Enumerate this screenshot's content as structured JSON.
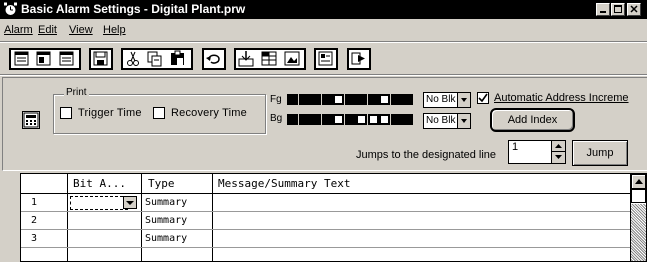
{
  "window": {
    "title": "Basic Alarm Settings - Digital Plant.prw",
    "icon": "clock-icon"
  },
  "menu": [
    "Alarm",
    "Edit",
    "View",
    "Help"
  ],
  "toolbar_icons": [
    "view-icon",
    "split-view-icon",
    "list-view-icon",
    "save-icon",
    "cut-icon",
    "copy-icon",
    "paste-icon",
    "undo-icon",
    "import-icon",
    "grid-icon",
    "image-icon",
    "properties-icon",
    "run-icon"
  ],
  "print": {
    "group_label": "Print",
    "trigger_label": "Trigger Time",
    "recovery_label": "Recovery Time",
    "trigger_checked": false,
    "recovery_checked": false
  },
  "colors": {
    "fg_label": "Fg",
    "bg_label": "Bg",
    "fg_swatches": [
      "#000000",
      "#000000",
      "#000000",
      "#000000",
      "#ffffff",
      "#000000",
      "#000000",
      "#000000",
      "#ffffff",
      "#000000",
      "#000000"
    ],
    "bg_swatches": [
      "#000000",
      "#000000",
      "#000000",
      "#000000",
      "#ffffff",
      "#000000",
      "#ffffff",
      "#ffffff",
      "#ffffff",
      "#000000",
      "#000000"
    ],
    "fg_blink": "No Blk",
    "bg_blink": "No Blk"
  },
  "auto_address": {
    "label": "Automatic Address Increme",
    "checked": true
  },
  "add_index_label": "Add Index",
  "jump": {
    "label": "Jumps to the designated line",
    "value": "1",
    "button": "Jump"
  },
  "grid": {
    "columns": [
      "",
      "Bit A...",
      "Type",
      "Message/Summary Text"
    ],
    "rows": [
      {
        "num": "1",
        "bit": "",
        "type": "Summary",
        "text": ""
      },
      {
        "num": "2",
        "bit": "",
        "type": "Summary",
        "text": ""
      },
      {
        "num": "3",
        "bit": "",
        "type": "Summary",
        "text": ""
      }
    ]
  }
}
